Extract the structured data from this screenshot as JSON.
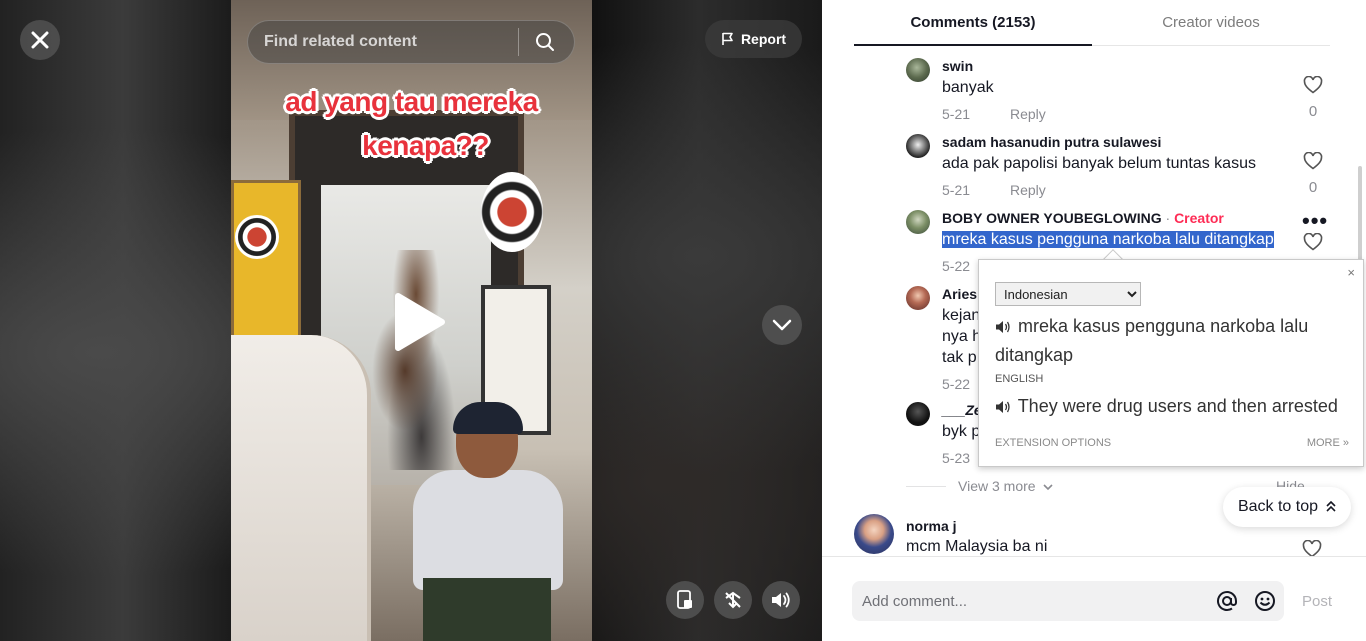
{
  "video": {
    "search_placeholder": "Find related content",
    "report_label": "Report",
    "caption_line1": "ad yang tau mereka",
    "caption_line2": "kenapa??"
  },
  "panel": {
    "tabs": [
      "Comments (2153)",
      "Creator videos"
    ],
    "replies": [
      {
        "user": "swin",
        "text": "banyak",
        "date": "5-21",
        "reply": "Reply",
        "likes": "0"
      },
      {
        "user": "sadam hasanudin putra sulawesi",
        "text": "ada pak papolisi banyak belum tuntas kasus",
        "date": "5-21",
        "reply": "Reply",
        "likes": "0"
      },
      {
        "user": "BOBY OWNER YOUBEGLOWING",
        "sep": " · ",
        "tag": "Creator",
        "text": "mreka kasus pengguna narkoba lalu ditangkap",
        "date": "5-22"
      },
      {
        "user": "Aries",
        "lines": [
          "kejan",
          "nya h",
          "tak p"
        ],
        "date": "5-22"
      },
      {
        "user": "___Ze",
        "text": "byk p",
        "date": "5-23"
      }
    ],
    "view_more": "View 3 more",
    "hide": "Hide",
    "back_to_top": "Back to top",
    "main_comment": {
      "user": "norma j",
      "text": "mcm Malaysia ba ni"
    },
    "add_comment_placeholder": "Add comment...",
    "post": "Post"
  },
  "translate_popup": {
    "close": "×",
    "language": "Indonesian",
    "source": "mreka kasus pengguna narkoba lalu ditangkap",
    "target_label": "ENGLISH",
    "target": "They were drug users and then arrested",
    "options": "EXTENSION OPTIONS",
    "more": "MORE »"
  },
  "colors": {
    "creator": "#fe2c55",
    "selection": "#3366cc",
    "caption": "#e8323c"
  }
}
